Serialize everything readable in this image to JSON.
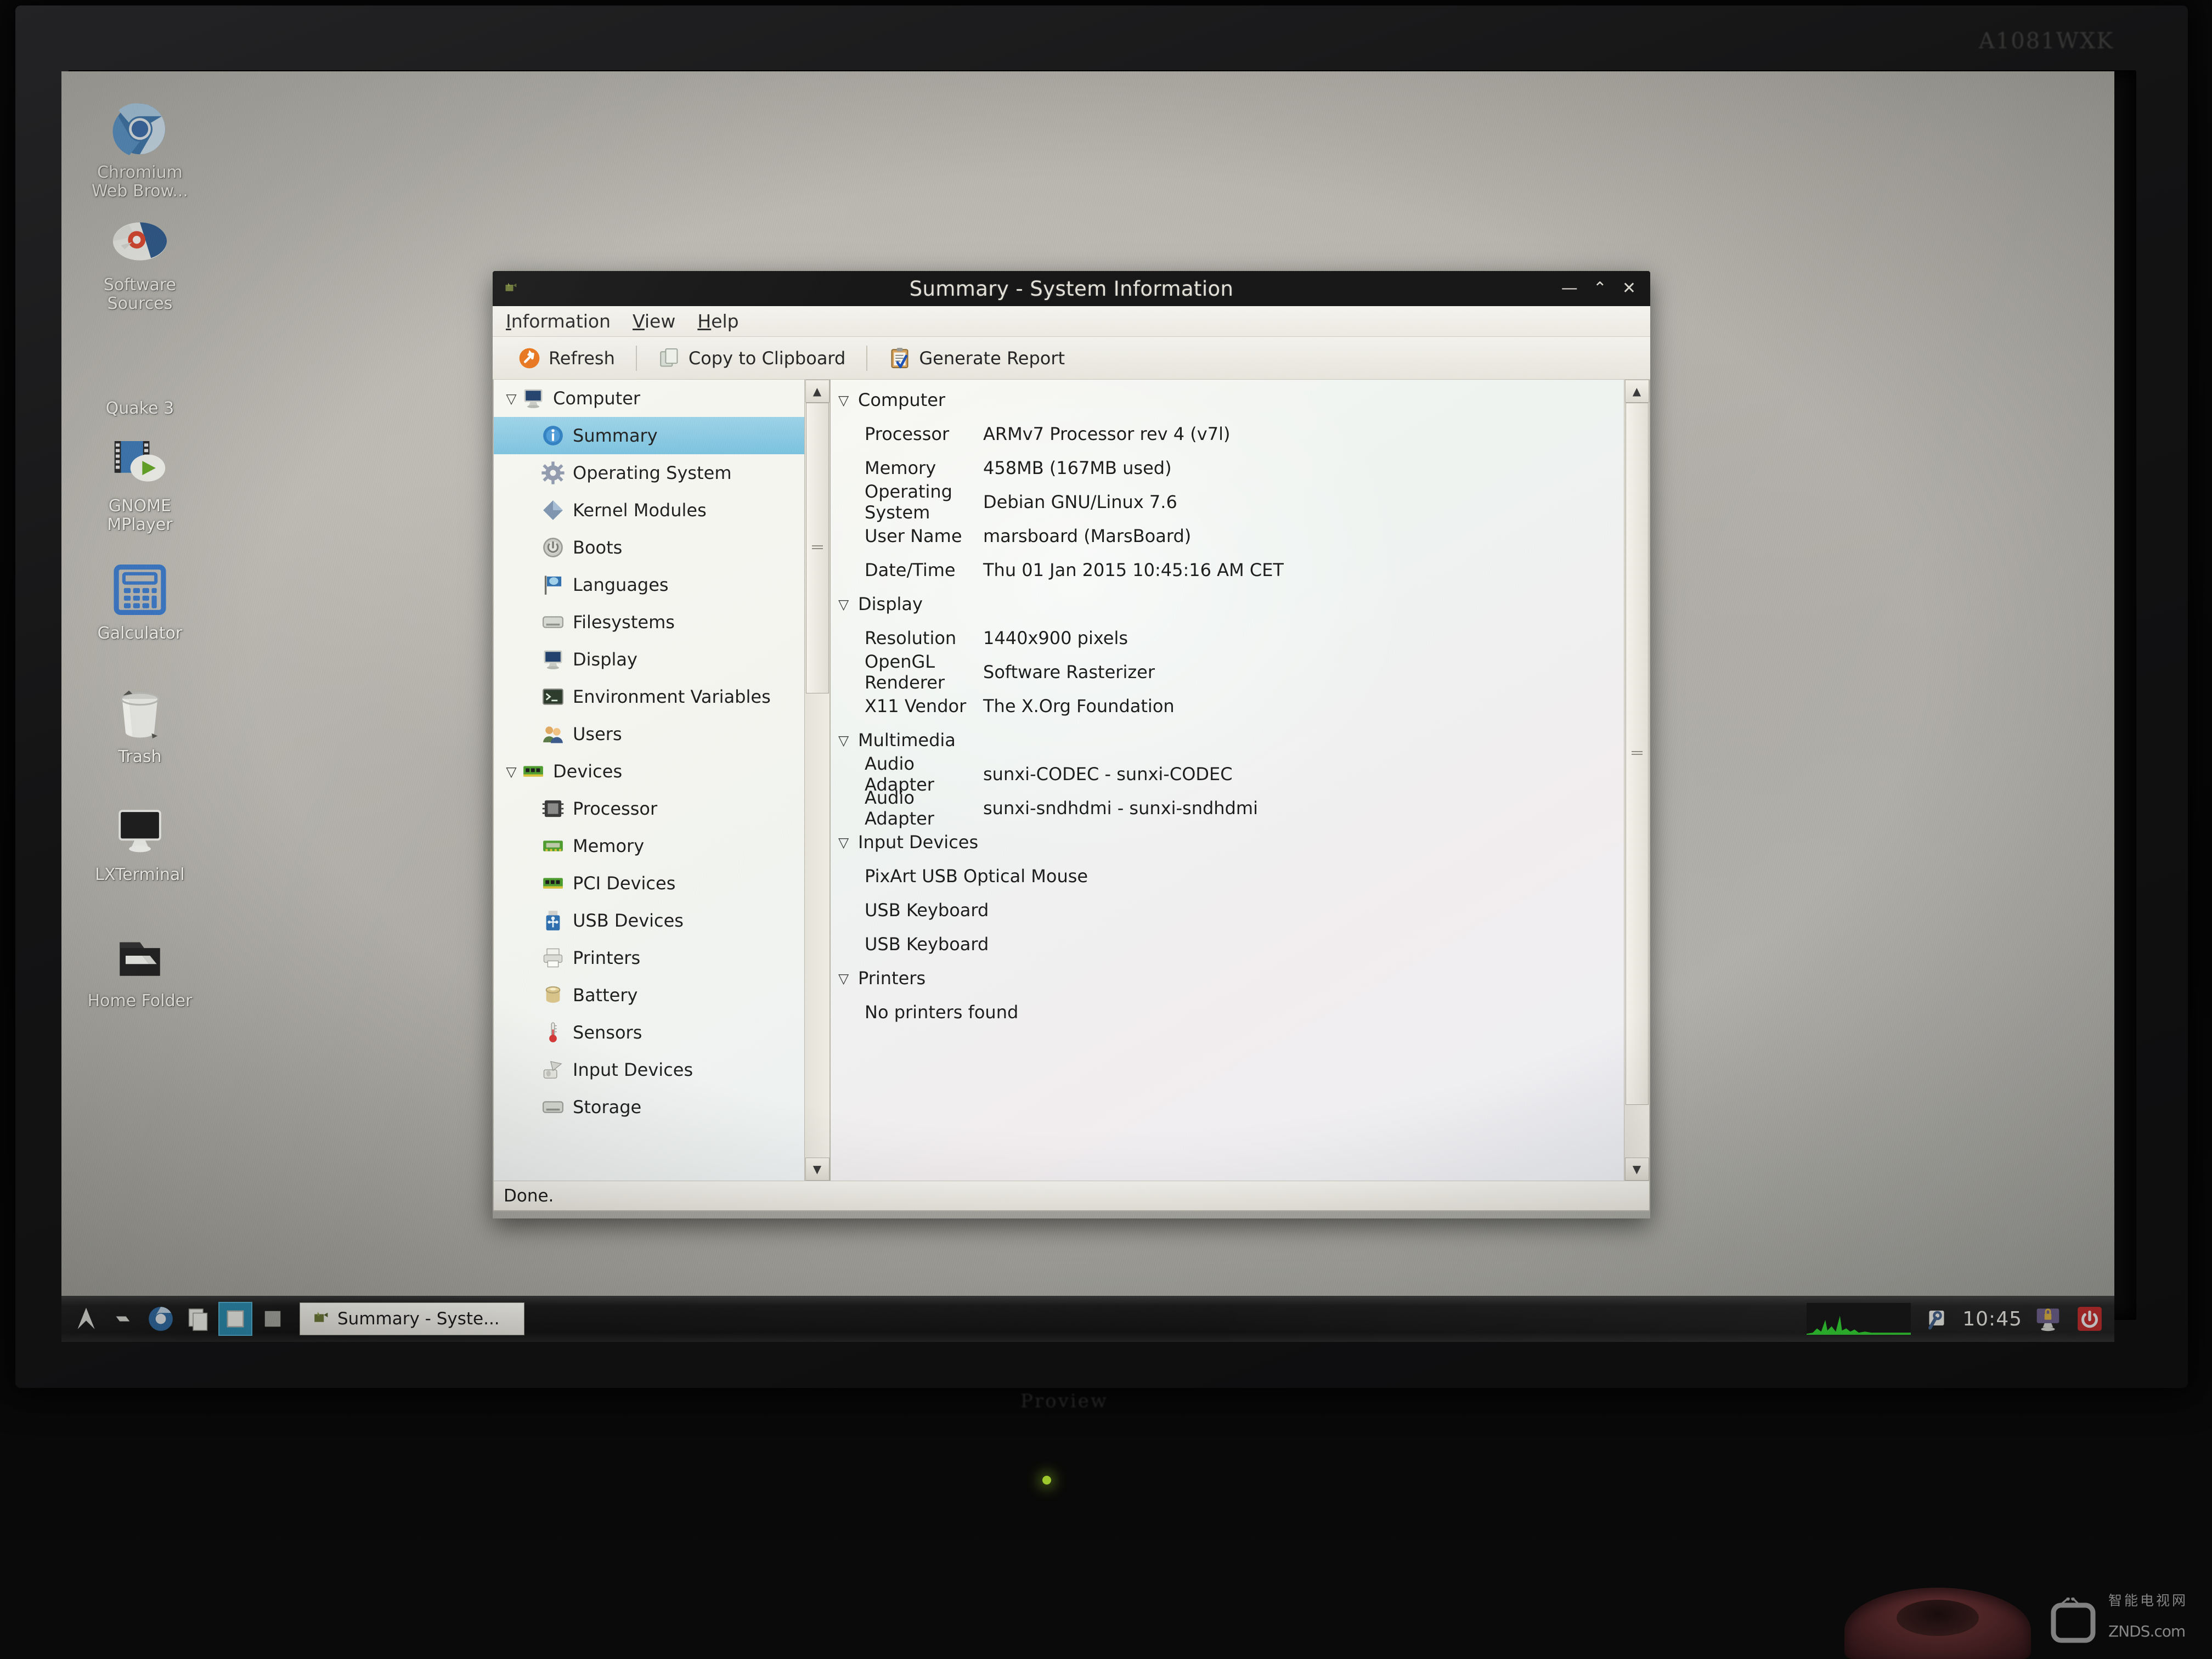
{
  "photo": {
    "monitor_bezel_brand": "A1081WXK",
    "monitor_bottom_logo": "Proview"
  },
  "watermark": {
    "chinese": "智能电视网",
    "main": "ZNDS",
    "suffix": ".com"
  },
  "desktop": {
    "icons": [
      {
        "label": "Chromium\nWeb Brow...",
        "icon": "chromium-icon"
      },
      {
        "label": "Software\nSources",
        "icon": "software-sources-icon"
      },
      {
        "label": "Quake 3",
        "icon": "quake3-icon"
      },
      {
        "label": "GNOME\nMPlayer",
        "icon": "gnome-mplayer-icon"
      },
      {
        "label": "Galculator",
        "icon": "calculator-icon"
      },
      {
        "label": "Trash",
        "icon": "trash-icon"
      },
      {
        "label": "LXTerminal",
        "icon": "terminal-icon"
      },
      {
        "label": "Home Folder",
        "icon": "home-folder-icon"
      }
    ]
  },
  "window": {
    "title": "Summary - System Information",
    "minimize_label": "—",
    "maximize_label": "⌃",
    "close_label": "✕",
    "menu": [
      {
        "label": "Information",
        "mnemonic": "I"
      },
      {
        "label": "View",
        "mnemonic": "V"
      },
      {
        "label": "Help",
        "mnemonic": "H"
      }
    ],
    "toolbar": [
      {
        "label": "Refresh",
        "icon": "refresh-icon"
      },
      {
        "label": "Copy to Clipboard",
        "icon": "copy-icon"
      },
      {
        "label": "Generate Report",
        "icon": "report-icon"
      }
    ],
    "statusbar": "Done."
  },
  "tree": [
    {
      "label": "Computer",
      "icon": "computer-icon",
      "level": 0,
      "twisty": "▽",
      "selected": false
    },
    {
      "label": "Summary",
      "icon": "info-icon",
      "level": 1,
      "twisty": "",
      "selected": true
    },
    {
      "label": "Operating System",
      "icon": "gear-icon",
      "level": 1,
      "twisty": "",
      "selected": false
    },
    {
      "label": "Kernel Modules",
      "icon": "module-icon",
      "level": 1,
      "twisty": "",
      "selected": false
    },
    {
      "label": "Boots",
      "icon": "power-icon",
      "level": 1,
      "twisty": "",
      "selected": false
    },
    {
      "label": "Languages",
      "icon": "flag-icon",
      "level": 1,
      "twisty": "",
      "selected": false
    },
    {
      "label": "Filesystems",
      "icon": "drive-icon",
      "level": 1,
      "twisty": "",
      "selected": false
    },
    {
      "label": "Display",
      "icon": "display-icon",
      "level": 1,
      "twisty": "",
      "selected": false
    },
    {
      "label": "Environment Variables",
      "icon": "terminal-icon",
      "level": 1,
      "twisty": "",
      "selected": false
    },
    {
      "label": "Users",
      "icon": "users-icon",
      "level": 1,
      "twisty": "",
      "selected": false
    },
    {
      "label": "Devices",
      "icon": "devices-icon",
      "level": 0,
      "twisty": "▽",
      "selected": false
    },
    {
      "label": "Processor",
      "icon": "cpu-icon",
      "level": 1,
      "twisty": "",
      "selected": false
    },
    {
      "label": "Memory",
      "icon": "memory-icon",
      "level": 1,
      "twisty": "",
      "selected": false
    },
    {
      "label": "PCI Devices",
      "icon": "pci-icon",
      "level": 1,
      "twisty": "",
      "selected": false
    },
    {
      "label": "USB Devices",
      "icon": "usb-icon",
      "level": 1,
      "twisty": "",
      "selected": false
    },
    {
      "label": "Printers",
      "icon": "printer-icon",
      "level": 1,
      "twisty": "",
      "selected": false
    },
    {
      "label": "Battery",
      "icon": "battery-icon",
      "level": 1,
      "twisty": "",
      "selected": false
    },
    {
      "label": "Sensors",
      "icon": "thermometer-icon",
      "level": 1,
      "twisty": "",
      "selected": false
    },
    {
      "label": "Input Devices",
      "icon": "input-devices-icon",
      "level": 1,
      "twisty": "",
      "selected": false
    },
    {
      "label": "Storage",
      "icon": "storage-icon",
      "level": 1,
      "twisty": "",
      "selected": false
    }
  ],
  "info": [
    {
      "type": "section",
      "twisty": "▽",
      "name": "Computer"
    },
    {
      "type": "pair",
      "key": "Processor",
      "value": "ARMv7 Processor rev 4 (v7l)"
    },
    {
      "type": "pair",
      "key": "Memory",
      "value": "458MB (167MB used)"
    },
    {
      "type": "pair",
      "key": "Operating System",
      "value": "Debian GNU/Linux 7.6"
    },
    {
      "type": "pair",
      "key": "User Name",
      "value": "marsboard (MarsBoard)"
    },
    {
      "type": "pair",
      "key": "Date/Time",
      "value": "Thu 01 Jan 2015 10:45:16 AM CET"
    },
    {
      "type": "section",
      "twisty": "▽",
      "name": "Display"
    },
    {
      "type": "pair",
      "key": "Resolution",
      "value": "1440x900 pixels"
    },
    {
      "type": "pair",
      "key": "OpenGL Renderer",
      "value": "Software Rasterizer"
    },
    {
      "type": "pair",
      "key": "X11 Vendor",
      "value": "The X.Org Foundation"
    },
    {
      "type": "section",
      "twisty": "▽",
      "name": "Multimedia"
    },
    {
      "type": "pair",
      "key": "Audio Adapter",
      "value": "sunxi-CODEC - sunxi-CODEC"
    },
    {
      "type": "pair",
      "key": "Audio Adapter",
      "value": "sunxi-sndhdmi - sunxi-sndhdmi"
    },
    {
      "type": "section",
      "twisty": "▽",
      "name": "Input Devices"
    },
    {
      "type": "solo",
      "value": "PixArt USB Optical Mouse"
    },
    {
      "type": "solo",
      "value": "USB Keyboard"
    },
    {
      "type": "solo",
      "value": "USB Keyboard"
    },
    {
      "type": "section",
      "twisty": "▽",
      "name": "Printers"
    },
    {
      "type": "solo",
      "value": "No printers found"
    }
  ],
  "taskbar": {
    "launchers": [
      {
        "icon": "lxde-menu-icon",
        "active": false
      },
      {
        "icon": "show-desktop-icon",
        "active": false
      },
      {
        "icon": "chromium-launcher-icon",
        "active": false
      },
      {
        "icon": "file-manager-icon",
        "active": false
      },
      {
        "icon": "desktop-1-icon",
        "active": true
      },
      {
        "icon": "desktop-2-icon",
        "active": false
      }
    ],
    "tasks": [
      {
        "label": "Summary - Syste...",
        "icon": "hardinfo-icon"
      }
    ],
    "tray": {
      "cpu_monitor": "cpu-graph-icon",
      "volume": "volume-icon",
      "clock": "10:45",
      "lock": "lock-screen-icon",
      "logout": "logout-icon"
    }
  },
  "colors": {
    "selection": "#7cc2de",
    "titlebar": "#171717",
    "taskbar_active": "#2b8fb5",
    "refresh_orange": "#e8741c",
    "logout_red": "#cc2222"
  }
}
